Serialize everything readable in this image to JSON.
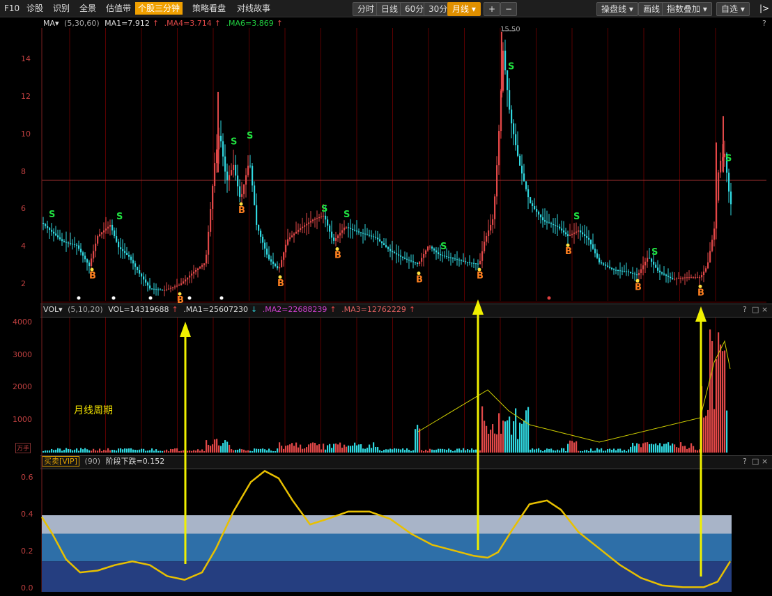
{
  "toolbar": {
    "left_items": [
      {
        "label": "F10",
        "active": false
      },
      {
        "label": "诊股",
        "active": false
      },
      {
        "label": "识别",
        "active": false
      },
      {
        "label": "全景",
        "active": false
      },
      {
        "label": "估值带",
        "active": false
      },
      {
        "label": "个股三分钟",
        "active": true
      },
      {
        "label": "策略看盘",
        "active": false
      },
      {
        "label": "对线故事",
        "active": false
      }
    ],
    "periods": [
      {
        "label": "分时",
        "active": false
      },
      {
        "label": "日线",
        "active": false
      },
      {
        "label": "60分",
        "active": false
      },
      {
        "label": "30分",
        "active": false
      },
      {
        "label": "月线",
        "active": true
      }
    ],
    "zoom_in": "+",
    "zoom_out": "−",
    "right_items": [
      "操盘线",
      "画线",
      "指数叠加",
      "自选"
    ],
    "collapse": "|>"
  },
  "price_panel": {
    "indicator": "MA▾",
    "params": "(5,30,60)",
    "ma1_label": "MA1=7.912",
    "ma4_label": ".MA4=3.714",
    "ma6_label": ".MA6=3.869",
    "help": "?",
    "y_ticks": [
      "14",
      "12",
      "10",
      "8",
      "6",
      "4",
      "2"
    ],
    "max_label": "15.50",
    "signal_buy": "B",
    "signal_sell": "S",
    "colors": {
      "up": "#e04848",
      "down": "#30d8e0",
      "grid": "#5a0000",
      "sell": "#20e040",
      "buy": "#ff8020"
    }
  },
  "vol_panel": {
    "indicator": "VOL▾",
    "params": "(5,10,20)",
    "vol_label": "VOL=14319688",
    "ma1_label": ".MA1=25607230",
    "ma2_label": ".MA2=22688239",
    "ma3_label": ".MA3=12762229",
    "y_ticks": [
      "4000",
      "3000",
      "2000",
      "1000"
    ],
    "unit": "万手",
    "annotation": "月线周期",
    "buttons": [
      "?",
      "□",
      "×"
    ]
  },
  "osc_panel": {
    "indicator": "买卖[VIP]",
    "params": "(90)",
    "value_label": "阶段下跌=0.152",
    "y_ticks": [
      "0.6",
      "0.4",
      "0.2",
      "0.0"
    ],
    "buttons": [
      "?",
      "□",
      "×"
    ],
    "colors": {
      "band_top": "#a8b4c8",
      "band_mid": "#2e6fa8",
      "band_low": "#253e80",
      "line": "#e8c000",
      "arrow": "#f0f000"
    }
  }
}
